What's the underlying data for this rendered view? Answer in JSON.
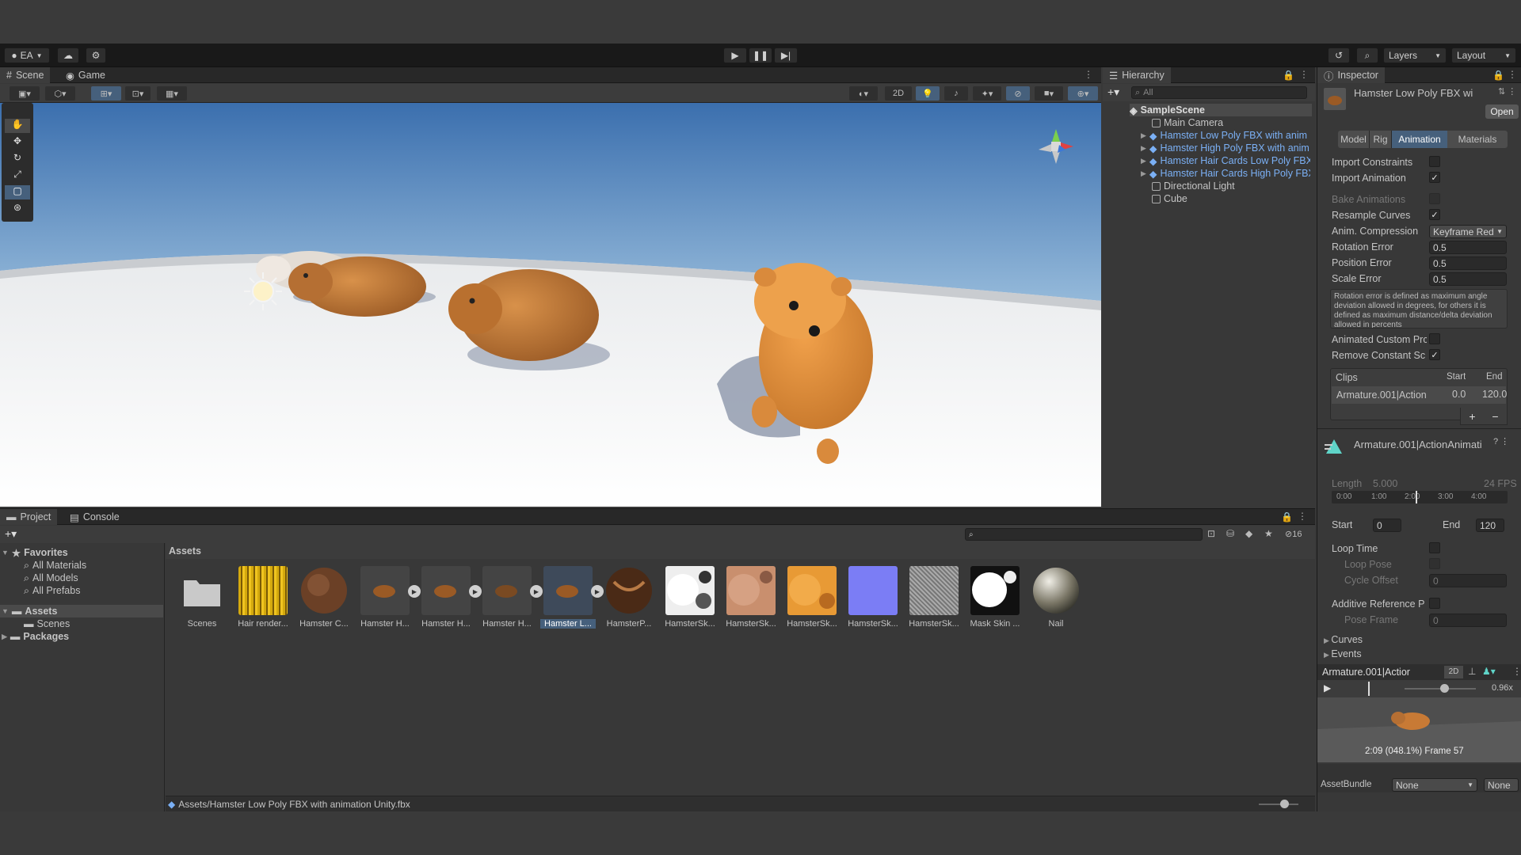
{
  "toolbar": {
    "account": "EA",
    "play_icons": [
      "play-icon",
      "pause-icon",
      "step-icon"
    ],
    "layers": "Layers",
    "layout": "Layout"
  },
  "scene_tabs": {
    "scene": "Scene",
    "game": "Game",
    "mode_2d": "2D"
  },
  "hierarchy": {
    "title": "Hierarchy",
    "search": "All",
    "scene": "SampleScene",
    "items": [
      "Main Camera",
      "Hamster Low Poly FBX with anim",
      "Hamster High Poly FBX with anim",
      "Hamster Hair Cards Low Poly FBX",
      "Hamster Hair Cards High Poly FBX",
      "Directional Light",
      "Cube"
    ]
  },
  "inspector": {
    "title": "Inspector",
    "asset_name": "Hamster Low Poly FBX wi",
    "open": "Open",
    "tabs": [
      "Model",
      "Rig",
      "Animation",
      "Materials"
    ],
    "import_constraints": "Import Constraints",
    "import_animation": "Import Animation",
    "bake_animations": "Bake Animations",
    "resample_curves": "Resample Curves",
    "anim_compression": "Anim. Compression",
    "anim_compression_value": "Keyframe Red",
    "rotation_error": "Rotation Error",
    "rotation_error_value": "0.5",
    "position_error": "Position Error",
    "position_error_value": "0.5",
    "scale_error": "Scale Error",
    "scale_error_value": "0.5",
    "help_text": "Rotation error is defined as maximum angle deviation allowed in degrees, for others it is defined as maximum distance/delta deviation allowed in percents",
    "animated_custom": "Animated Custom Prc",
    "remove_constant": "Remove Constant Sc",
    "clips": "Clips",
    "start": "Start",
    "end": "End",
    "clip_name": "Armature.001|Action",
    "clip_start": "0.0",
    "clip_end": "120.0",
    "plus": "+",
    "minus": "−",
    "clip_title": "Armature.001|ActionAnimati",
    "length_label": "Length",
    "length_value": "5.000",
    "fps": "24 FPS",
    "ticks": [
      "0:00",
      "1:00",
      "2:00",
      "3:00",
      "4:00"
    ],
    "start_value": "0",
    "end_value": "120",
    "loop_time": "Loop Time",
    "loop_pose": "Loop Pose",
    "cycle_offset": "Cycle Offset",
    "cycle_offset_value": "0",
    "additive_ref": "Additive Reference P",
    "pose_frame": "Pose Frame",
    "pose_frame_value": "0",
    "curves": "Curves",
    "events": "Events",
    "preview_title": "Armature.001|Actior",
    "preview_2d": "2D",
    "speed": "0.96x",
    "preview_status": "2:09 (048.1%) Frame 57",
    "assetbundle": "AssetBundle",
    "assetbundle_value": "None",
    "assetbundle_variant": "None"
  },
  "project": {
    "tab": "Project",
    "console": "Console",
    "count": "16",
    "favorites": "Favorites",
    "fav_items": [
      "All Materials",
      "All Models",
      "All Prefabs"
    ],
    "assets": "Assets",
    "scenes": "Scenes",
    "packages": "Packages",
    "breadcrumb": "Assets",
    "asset_items": [
      "Scenes",
      "Hair render...",
      "Hamster C...",
      "Hamster H...",
      "Hamster H...",
      "Hamster H...",
      "Hamster L...",
      "HamsterP...",
      "HamsterSk...",
      "HamsterSk...",
      "HamsterSk...",
      "HamsterSk...",
      "HamsterSk...",
      "Mask Skin ...",
      "Nail"
    ],
    "status_path": "Assets/Hamster Low Poly FBX with animation Unity.fbx"
  },
  "colors": {
    "accent": "#46607c",
    "prefab": "#7bb0f5",
    "hamster": "#c87a35"
  }
}
